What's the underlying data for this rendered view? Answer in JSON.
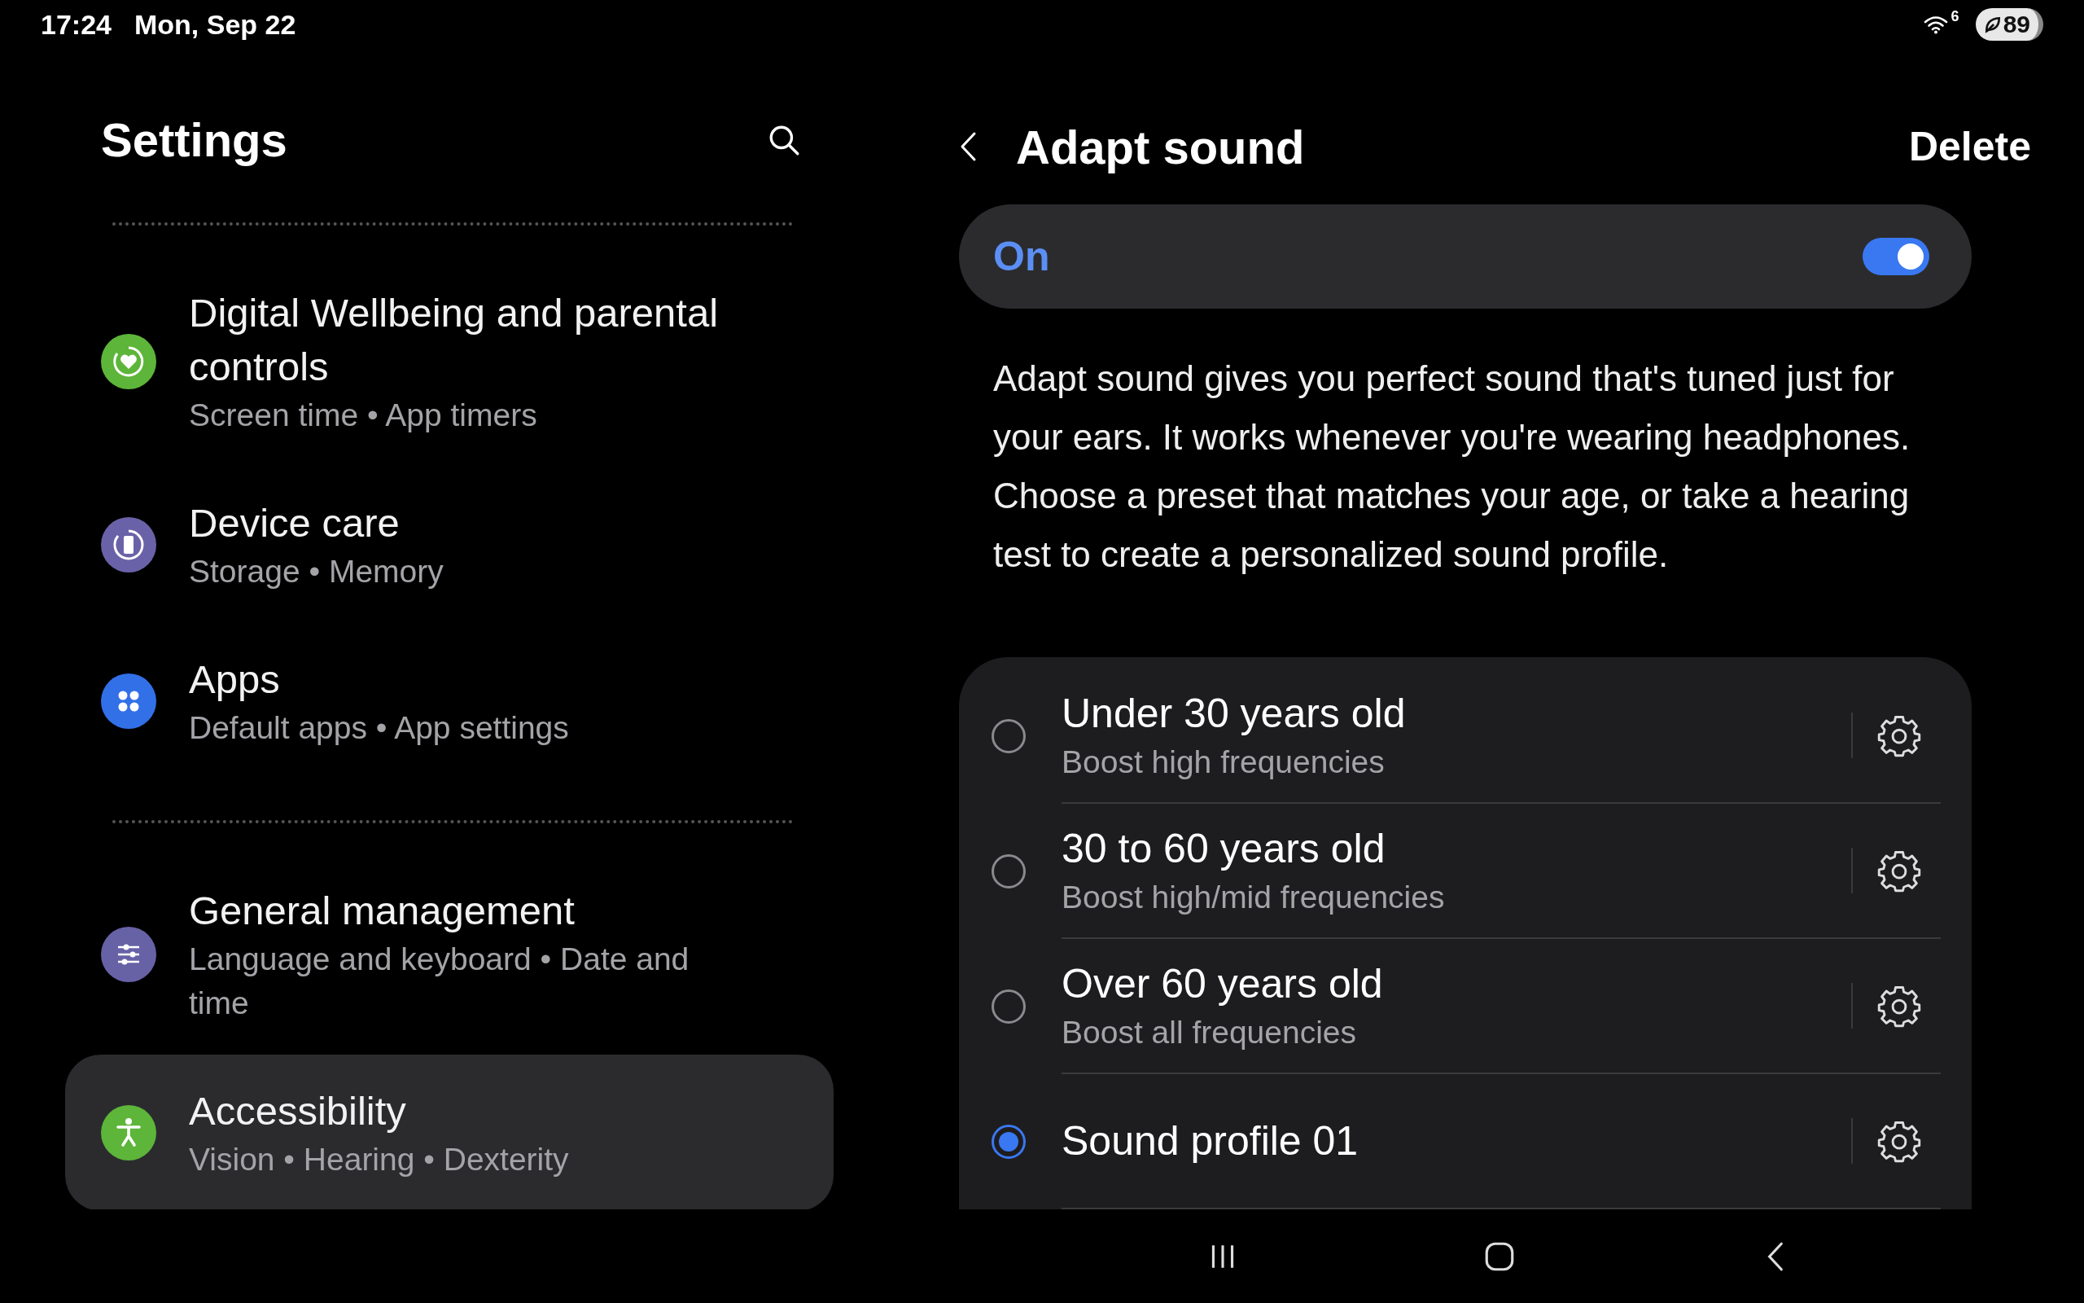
{
  "status_bar": {
    "time": "17:24",
    "date": "Mon, Sep 22",
    "wifi_label": "6",
    "battery": "89"
  },
  "settings": {
    "title": "Settings",
    "groups": [
      [
        {
          "kind": "heart",
          "color": "#5db53a",
          "title": "Digital Wellbeing and parental controls",
          "subtitle": "Screen time  •  App timers",
          "selected": false
        },
        {
          "kind": "device",
          "color": "#6a62a8",
          "title": "Device care",
          "subtitle": "Storage  •  Memory",
          "selected": false
        },
        {
          "kind": "apps",
          "color": "#3270e8",
          "title": "Apps",
          "subtitle": "Default apps  •  App settings",
          "selected": false
        }
      ],
      [
        {
          "kind": "sliders",
          "color": "#6762a6",
          "title": "General management",
          "subtitle": "Language and keyboard  •  Date and time",
          "selected": false
        },
        {
          "kind": "person",
          "color": "#5db53a",
          "title": "Accessibility",
          "subtitle": "Vision  •  Hearing  •  Dexterity",
          "selected": true
        }
      ]
    ]
  },
  "detail": {
    "title": "Adapt sound",
    "action": "Delete",
    "master": {
      "label": "On",
      "on": true
    },
    "description": "Adapt sound gives you perfect sound that's tuned just for your ears. It works whenever you're wearing headphones. Choose a preset that matches your age, or take a hearing test to create a personalized sound profile.",
    "presets": [
      {
        "title": "Under 30 years old",
        "subtitle": "Boost high frequencies",
        "selected": false
      },
      {
        "title": "30 to 60 years old",
        "subtitle": "Boost high/mid frequencies",
        "selected": false
      },
      {
        "title": "Over 60 years old",
        "subtitle": "Boost all frequencies",
        "selected": false
      },
      {
        "title": "Sound profile 01",
        "selected": true
      }
    ]
  }
}
